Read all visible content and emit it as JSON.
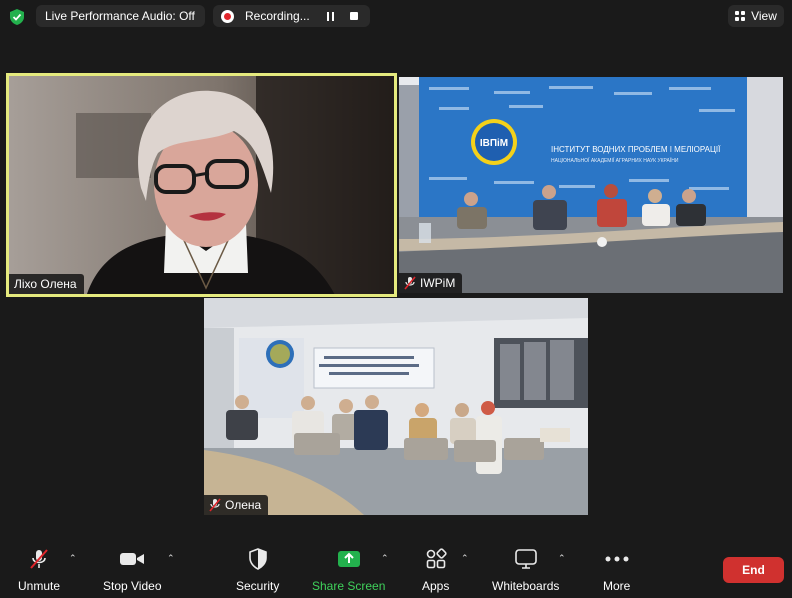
{
  "topbar": {
    "performance_audio": "Live Performance Audio: Off",
    "recording": "Recording...",
    "view": "View"
  },
  "participants": [
    {
      "name": "Ліхо Олена",
      "speaking": true
    },
    {
      "name": "IWPiM",
      "muted": true
    },
    {
      "name": "Олена",
      "muted": true
    }
  ],
  "banner": {
    "logo_text": "ІВПіМ",
    "line1": "ІНСТИТУТ ВОДНИХ ПРОБЛЕМ І МЕЛІОРАЦІЇ",
    "line2": "НАЦІОНАЛЬНОЇ АКАДЕМІЇ АГРАРНИХ НАУК УКРАЇНИ"
  },
  "toolbar": {
    "unmute": "Unmute",
    "stop_video": "Stop Video",
    "security": "Security",
    "share_screen": "Share Screen",
    "apps": "Apps",
    "whiteboards": "Whiteboards",
    "more": "More",
    "end": "End"
  },
  "colors": {
    "active_speaker_border": "#e5ea7e",
    "share_green": "#3fd15b",
    "end_red": "#d0312f",
    "record_red": "#e0252b"
  }
}
